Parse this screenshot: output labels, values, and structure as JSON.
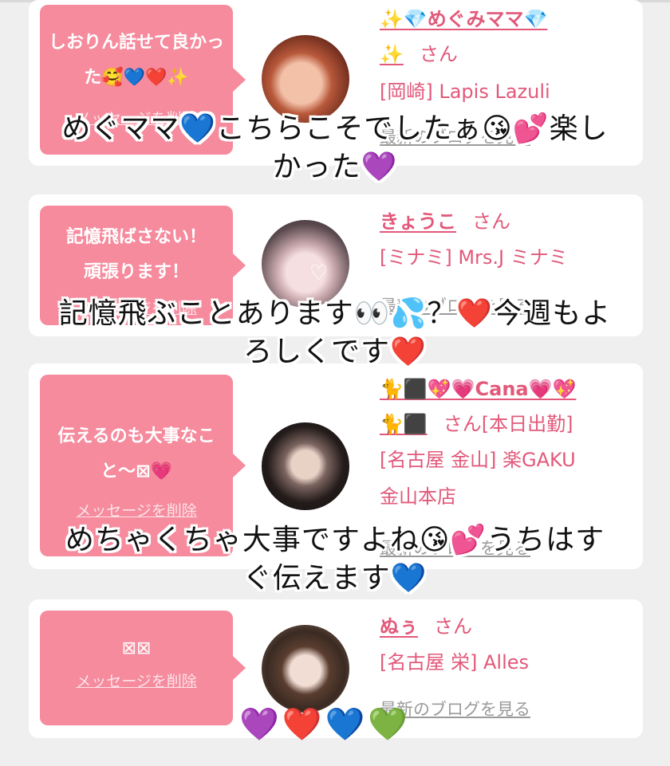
{
  "cards": [
    {
      "message": "しおりん話せて良かった🥰💙❤️✨",
      "delete_label": "メッセージを削除",
      "name_prefix": "✨💎めぐみママ💎",
      "name_tail": "✨",
      "san": "さん",
      "shop": "[岡崎] Lapis Lazuli",
      "blog_label": "最新のブログを見る"
    },
    {
      "message": "記憶飛ばさない！頑張ります！",
      "delete_label": "メッセージを削除",
      "name": "きょうこ",
      "san": "さん",
      "shop": "[ミナミ] Mrs.J ミナミ",
      "blog_label": "最新のブログを見る"
    },
    {
      "message": "伝えるのも大事なこと〜⊠💗",
      "delete_label": "メッセージを削除",
      "name_prefix": "🐈⬛💖💗Cana💗💖",
      "name_tail": "🐈⬛",
      "san": "さん[本日出勤]",
      "shop_line1": "[名古屋 金山] 楽GAKU",
      "shop_line2": "金山本店",
      "blog_label": "最新のブログを見る"
    },
    {
      "message": "⊠⊠",
      "delete_label": "メッセージを削除",
      "name": "ぬぅ",
      "san": "さん",
      "shop": "[名古屋 栄] Alles",
      "blog_label": "最新のブログを見る"
    }
  ],
  "overlays": {
    "o1_line1": "めぐママ💙こちらこそでしたぁ😘💕楽し",
    "o1_line2": "かった💜",
    "o2_line1": "記憶飛ぶことあります👀💦？❤️今週もよ",
    "o2_line2": "ろしくです❤️",
    "o3_line1": "めちゃくちゃ大事ですよね😘💕うちはす",
    "o3_line2": "ぐ伝えます💙",
    "hearts": "💜❤️💙💚"
  },
  "colors": {
    "accent_pink": "#f58b9d",
    "name_pink": "#e2597a",
    "card_bg": "#ffffff",
    "page_bg": "#efefef"
  }
}
